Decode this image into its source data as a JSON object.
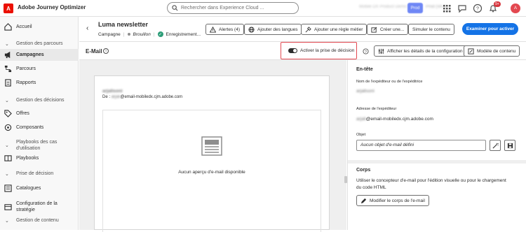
{
  "app": {
    "logo": "A",
    "name": "Adobe Journey Optimizer"
  },
  "topbar": {
    "search_placeholder": "Rechercher dans Experience Cloud ...",
    "org_name": "Mobile DX Product Demo",
    "beta_label": "Prod",
    "sandbox_name": "Prod (VA7)",
    "notification_count": "9+",
    "avatar_initials": "A",
    "icons": [
      "apps-icon",
      "chat-icon",
      "help-icon",
      "bell-icon",
      "avatar"
    ]
  },
  "sidebar": {
    "items": [
      {
        "label": "Accueil",
        "type": "item",
        "icon": "home-icon"
      },
      {
        "label": "Gestion des parcours",
        "type": "section"
      },
      {
        "label": "Campagnes",
        "type": "item",
        "icon": "megaphone-icon",
        "active": true
      },
      {
        "label": "Parcours",
        "type": "item",
        "icon": "journey-icon"
      },
      {
        "label": "Rapports",
        "type": "item",
        "icon": "report-icon"
      },
      {
        "label": "Gestion des décisions",
        "type": "section"
      },
      {
        "label": "Offres",
        "type": "item",
        "icon": "offer-icon"
      },
      {
        "label": "Composants",
        "type": "item",
        "icon": "components-icon"
      },
      {
        "label": "Playbooks des cas d'utilisation",
        "type": "section"
      },
      {
        "label": "Playbooks",
        "type": "item",
        "icon": "playbook-icon"
      },
      {
        "label": "Prise de décision",
        "type": "section"
      },
      {
        "label": "Catalogues",
        "type": "item",
        "icon": "catalog-icon"
      },
      {
        "label": "Configuration de la stratégie",
        "type": "item",
        "icon": "strategy-icon"
      },
      {
        "label": "Gestion de contenu",
        "type": "section"
      }
    ]
  },
  "header": {
    "title": "Luma newsletter",
    "type_label": "Campagne",
    "status_label": "Brouillon",
    "save_status": "Enregistrement...",
    "buttons": {
      "alerts": "Alertes (4)",
      "languages": "Ajouter des langues",
      "business_rule": "Ajouter une règle métier",
      "create": "Créer une...",
      "simulate": "Simuler le contenu",
      "review": "Examiner pour activer"
    }
  },
  "email_bar": {
    "title": "E-Mail",
    "toggle_label": "Activer la prise de décision",
    "toggle_on": true,
    "config_button": "Afficher les détails de la configuration",
    "template_button": "Modèle de contenu"
  },
  "preview": {
    "sender_name": "arjalisoni",
    "from_prefix": "De :",
    "from_user": "arjali",
    "from_domain": "@email-mobiledx.cjm.adobe.com",
    "empty_text": "Aucun aperçu d'e-mail disponible"
  },
  "right_panel": {
    "header_title": "En-tête",
    "sender_name_label": "Nom de l'expéditeur ou de l'expéditrice",
    "sender_name_value": "arjalisoni",
    "sender_address_label": "Adresse de l'expéditeur",
    "sender_address_user": "arjali",
    "sender_address_domain": "@email-mobiledx.cjm.adobe.com",
    "subject_label": "Objet",
    "subject_value": "Aucun objet d'e-mail défini",
    "body_title": "Corps",
    "body_text": "Utiliser le concepteur d'e-mail pour l'édition visuelle ou pour le chargement du code HTML",
    "edit_body_button": "Modifier le corps de l'e-mail"
  },
  "colors": {
    "accent": "#1473e6",
    "highlight_border": "#e34850",
    "success": "#2d9d78",
    "brand": "#eb1000"
  }
}
